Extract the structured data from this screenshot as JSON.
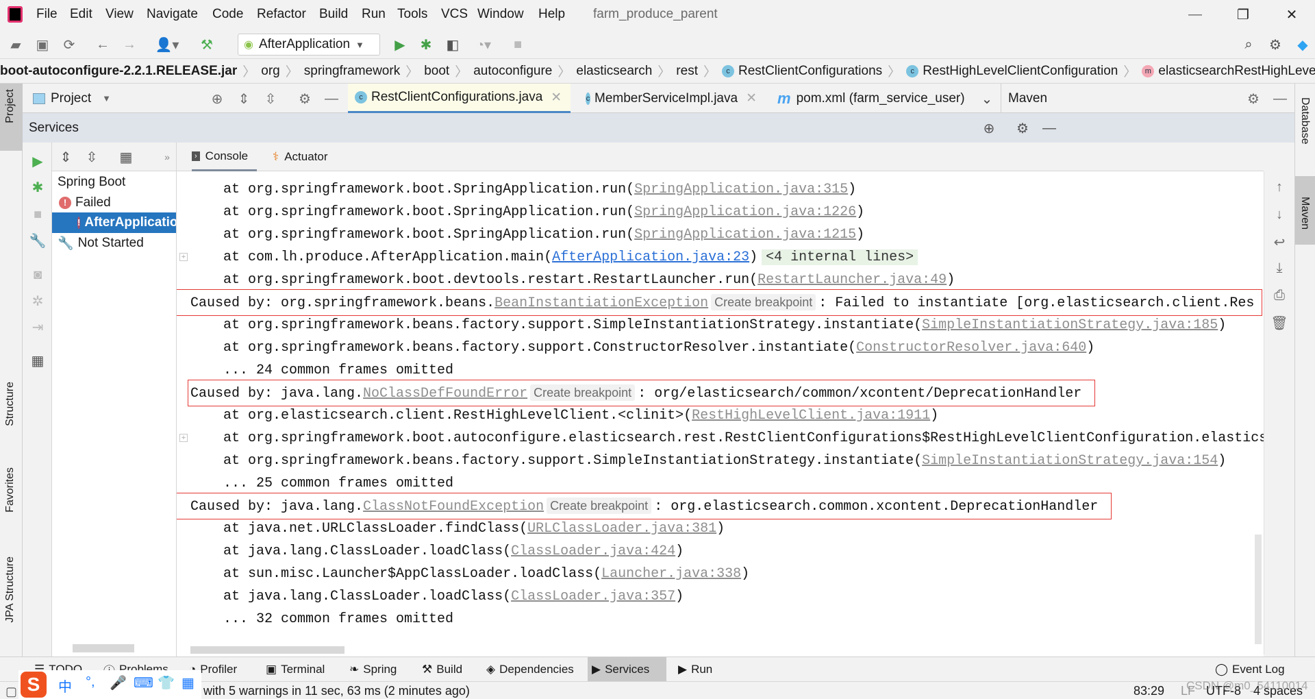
{
  "menu": {
    "items": [
      "File",
      "Edit",
      "View",
      "Navigate",
      "Code",
      "Refactor",
      "Build",
      "Run",
      "Tools",
      "VCS",
      "Window",
      "Help"
    ],
    "project_title": "farm_produce_parent"
  },
  "toolbar": {
    "run_config": "AfterApplication"
  },
  "breadcrumb": [
    "boot-autoconfigure-2.2.1.RELEASE.jar",
    "org",
    "springframework",
    "boot",
    "autoconfigure",
    "elasticsearch",
    "rest",
    "RestClientConfigurations",
    "RestHighLevelClientConfiguration",
    "elasticsearchRestHighLevelClient"
  ],
  "project_pane": {
    "label": "Project"
  },
  "editor_tabs": [
    {
      "label": "RestClientConfigurations.java",
      "icon": "class-icon"
    },
    {
      "label": "MemberServiceImpl.java",
      "icon": "class-icon"
    },
    {
      "label": "pom.xml (farm_service_user)",
      "icon": "maven-icon"
    }
  ],
  "maven_pane": {
    "label": "Maven"
  },
  "left_strip": {
    "project": "Project",
    "structure": "Structure",
    "favorites": "Favorites",
    "jpa": "JPA Structure"
  },
  "right_strip": {
    "database": "Database",
    "maven": "Maven"
  },
  "services": {
    "title": "Services",
    "tree": {
      "spring_boot": "Spring Boot",
      "failed": "Failed",
      "app": "AfterApplication",
      "not_started": "Not Started"
    },
    "console_tabs": {
      "console": "Console",
      "actuator": "Actuator"
    }
  },
  "console_lines": [
    {
      "indent": true,
      "seg": [
        [
          "t",
          "at org.springframework.boot.SpringApplication.run("
        ],
        [
          "l",
          "SpringApplication.java:315"
        ],
        [
          "t",
          ")"
        ]
      ]
    },
    {
      "indent": true,
      "seg": [
        [
          "t",
          "at org.springframework.boot.SpringApplication.run("
        ],
        [
          "l",
          "SpringApplication.java:1226"
        ],
        [
          "t",
          ")"
        ]
      ]
    },
    {
      "indent": true,
      "seg": [
        [
          "t",
          "at org.springframework.boot.SpringApplication.run("
        ],
        [
          "l",
          "SpringApplication.java:1215"
        ],
        [
          "t",
          ")"
        ]
      ]
    },
    {
      "indent": true,
      "foldable": true,
      "seg": [
        [
          "t",
          "at com.lh.produce.AfterApplication.main("
        ],
        [
          "b",
          "AfterApplication.java:23"
        ],
        [
          "t",
          ")"
        ],
        [
          "f",
          "<4 internal lines>"
        ]
      ]
    },
    {
      "indent": true,
      "seg": [
        [
          "t",
          "at org.springframework.boot.devtools.restart.RestartLauncher.run("
        ],
        [
          "l",
          "RestartLauncher.java:49"
        ],
        [
          "t",
          ")"
        ]
      ]
    },
    {
      "indent": false,
      "boxed": true,
      "seg": [
        [
          "t",
          "Caused by: org.springframework.beans."
        ],
        [
          "l",
          "BeanInstantiationException"
        ],
        [
          "c",
          "Create breakpoint"
        ],
        [
          "t",
          ": Failed to instantiate [org.elasticsearch.client.Res"
        ]
      ]
    },
    {
      "indent": true,
      "seg": [
        [
          "t",
          "at org.springframework.beans.factory.support.SimpleInstantiationStrategy.instantiate("
        ],
        [
          "l",
          "SimpleInstantiationStrategy.java:185"
        ],
        [
          "t",
          ")"
        ]
      ]
    },
    {
      "indent": true,
      "seg": [
        [
          "t",
          "at org.springframework.beans.factory.support.ConstructorResolver.instantiate("
        ],
        [
          "l",
          "ConstructorResolver.java:640"
        ],
        [
          "t",
          ")"
        ]
      ]
    },
    {
      "indent": true,
      "seg": [
        [
          "t",
          "... 24 common frames omitted"
        ]
      ]
    },
    {
      "indent": false,
      "boxed": true,
      "seg": [
        [
          "t",
          "Caused by: java.lang."
        ],
        [
          "l",
          "NoClassDefFoundError"
        ],
        [
          "c",
          "Create breakpoint"
        ],
        [
          "t",
          ": org/elasticsearch/common/xcontent/DeprecationHandler"
        ]
      ]
    },
    {
      "indent": true,
      "seg": [
        [
          "t",
          "at org.elasticsearch.client.RestHighLevelClient.<clinit>("
        ],
        [
          "l",
          "RestHighLevelClient.java:1911"
        ],
        [
          "t",
          ")"
        ]
      ]
    },
    {
      "indent": true,
      "foldable": true,
      "seg": [
        [
          "t",
          "at org.springframework.boot.autoconfigure.elasticsearch.rest.RestClientConfigurations$RestHighLevelClientConfiguration.elastics"
        ]
      ]
    },
    {
      "indent": true,
      "seg": [
        [
          "t",
          "at org.springframework.beans.factory.support.SimpleInstantiationStrategy.instantiate("
        ],
        [
          "l",
          "SimpleInstantiationStrategy.java:154"
        ],
        [
          "t",
          ")"
        ]
      ]
    },
    {
      "indent": true,
      "seg": [
        [
          "t",
          "... 25 common frames omitted"
        ]
      ]
    },
    {
      "indent": false,
      "boxed": true,
      "seg": [
        [
          "t",
          "Caused by: java.lang."
        ],
        [
          "l",
          "ClassNotFoundException"
        ],
        [
          "c",
          "Create breakpoint"
        ],
        [
          "t",
          ": org.elasticsearch.common.xcontent.DeprecationHandler"
        ]
      ]
    },
    {
      "indent": true,
      "seg": [
        [
          "t",
          "at java.net.URLClassLoader.findClass("
        ],
        [
          "l",
          "URLClassLoader.java:381"
        ],
        [
          "t",
          ")"
        ]
      ]
    },
    {
      "indent": true,
      "seg": [
        [
          "t",
          "at java.lang.ClassLoader.loadClass("
        ],
        [
          "l",
          "ClassLoader.java:424"
        ],
        [
          "t",
          ")"
        ]
      ]
    },
    {
      "indent": true,
      "seg": [
        [
          "t",
          "at sun.misc.Launcher$AppClassLoader.loadClass("
        ],
        [
          "l",
          "Launcher.java:338"
        ],
        [
          "t",
          ")"
        ]
      ]
    },
    {
      "indent": true,
      "seg": [
        [
          "t",
          "at java.lang.ClassLoader.loadClass("
        ],
        [
          "l",
          "ClassLoader.java:357"
        ],
        [
          "t",
          ")"
        ]
      ]
    },
    {
      "indent": true,
      "seg": [
        [
          "t",
          "... 32 common frames omitted"
        ]
      ]
    }
  ],
  "bottom_tabs": {
    "todo": "TODO",
    "problems": "Problems",
    "profiler": "Profiler",
    "terminal": "Terminal",
    "spring": "Spring",
    "build": "Build",
    "dependencies": "Dependencies",
    "services": "Services",
    "run": "Run",
    "event_log": "Event Log"
  },
  "status": {
    "message": "with 5 warnings in 11 sec, 63 ms (2 minutes ago)",
    "position": "83:29",
    "line_sep": "LF",
    "encoding": "UTF-8",
    "indent": "4 spaces",
    "watermark": "CSDN @m0_54110014"
  },
  "colors": {
    "accent": "#2675bf",
    "error_box": "#e53935",
    "link": "#2a6fd6",
    "run_green": "#4caf50"
  }
}
